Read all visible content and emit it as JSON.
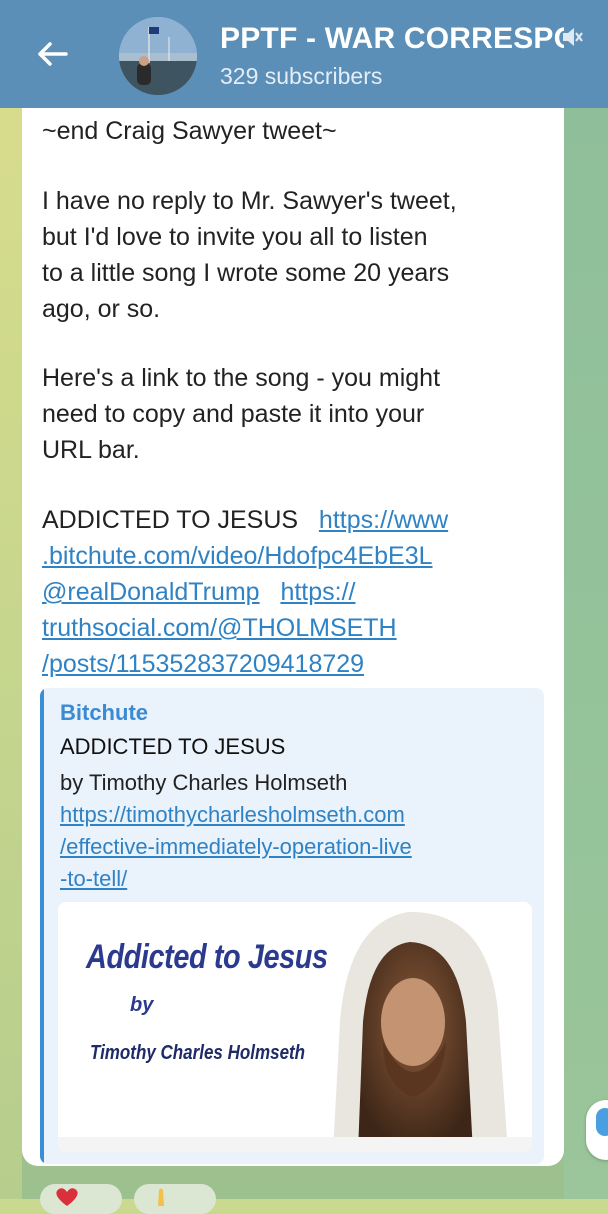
{
  "header": {
    "title": "PPTF - WAR CORRESPONDENT",
    "subtitle": "329 subscribers"
  },
  "message": {
    "line_end_tweet": "~end Craig Sawyer tweet~",
    "para1": [
      "I have no reply to Mr. Sawyer's tweet,",
      "but I'd love to invite you all to listen",
      "to a little song I wrote some 20 years",
      "ago, or so."
    ],
    "para2": [
      "Here's a link to the song - you might",
      "need to copy and paste it into your",
      "URL bar."
    ],
    "song_title": "ADDICTED TO JESUS",
    "link1_part1": "https://www",
    "link1_part2": ".bitchute.com/video/Hdofpc4EbE3L",
    "mention": "@realDonaldTrump",
    "link2_part1": "https://",
    "link2_part2": "truthsocial.com/@THOLMSETH",
    "link2_part3": "/posts/115352837209418729"
  },
  "preview": {
    "site": "Bitchute",
    "title": "ADDICTED TO JESUS",
    "author_line": "by Timothy Charles Holmseth",
    "link_lines": [
      "https://timothycharlesholmseth.com",
      "/effective-immediately-operation-live",
      "-to-tell/"
    ],
    "image_text": {
      "headline": "Addicted to Jesus",
      "by": "by",
      "author": "Timothy Charles Holmseth"
    }
  },
  "colors": {
    "header_bg": "#5b8fb7",
    "link": "#2f82c4",
    "card_accent": "#3b8ed6"
  },
  "icons": [
    "back-arrow-icon",
    "mute-icon",
    "channel-avatar"
  ]
}
